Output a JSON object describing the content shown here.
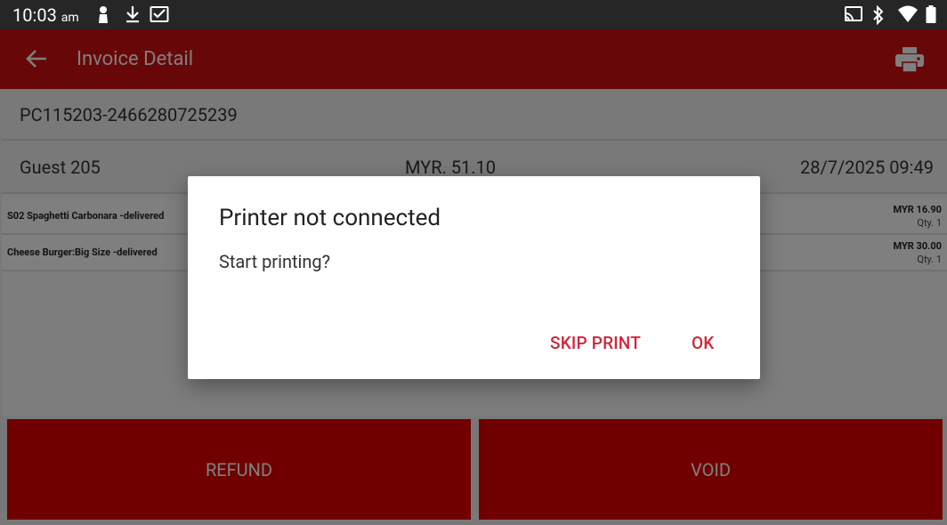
{
  "status_bar": {
    "time": "10:03",
    "ampm": "am",
    "left_icons": [
      "person-icon",
      "download-icon",
      "inbox-icon"
    ],
    "right_icons": [
      "cast-icon",
      "bluetooth-icon",
      "wifi-icon",
      "battery-icon"
    ]
  },
  "app_bar": {
    "title": "Invoice Detail",
    "back_icon": "arrow-back-icon",
    "print_icon": "printer-icon",
    "color": "#d10f0f"
  },
  "invoice": {
    "number": "PC115203-2466280725239",
    "guest": "Guest 205",
    "total": "MYR. 51.10",
    "datetime": "28/7/2025 09:49"
  },
  "items": [
    {
      "name": "S02 Spaghetti Carbonara  -delivered",
      "price": "MYR 16.90",
      "qty": "Qty. 1"
    },
    {
      "name": "Cheese Burger:Big Size  -delivered",
      "price": "MYR 30.00",
      "qty": "Qty. 1"
    }
  ],
  "actions": {
    "refund": "REFUND",
    "void": "VOID"
  },
  "dialog": {
    "title": "Printer not connected",
    "message": "Start printing?",
    "skip_label": "SKIP PRINT",
    "ok_label": "OK",
    "accent": "#d3243a"
  }
}
